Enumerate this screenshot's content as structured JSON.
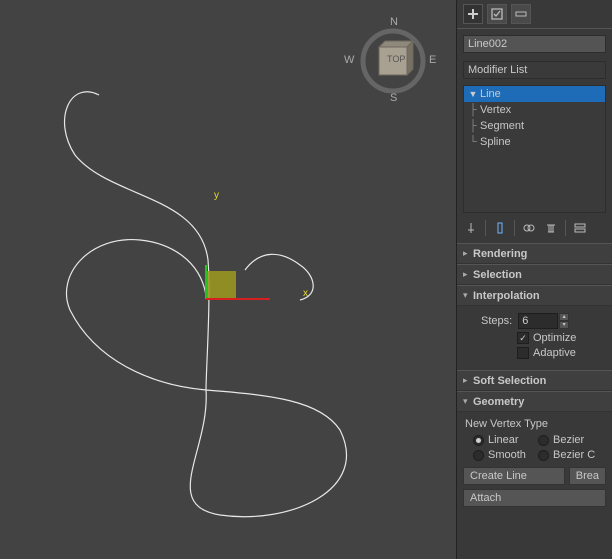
{
  "object_name": "Line002",
  "modifier_dropdown": "Modifier List",
  "stack": {
    "root": "Line",
    "subs": [
      "Vertex",
      "Segment",
      "Spline"
    ]
  },
  "rollouts": {
    "rendering": "Rendering",
    "selection": "Selection",
    "interpolation": "Interpolation",
    "soft_selection": "Soft Selection",
    "geometry": "Geometry"
  },
  "interpolation": {
    "steps_label": "Steps:",
    "steps_value": "6",
    "optimize_label": "Optimize",
    "optimize_checked": true,
    "adaptive_label": "Adaptive",
    "adaptive_checked": false
  },
  "geometry": {
    "new_vertex_label": "New Vertex Type",
    "linear": "Linear",
    "bezier": "Bezier",
    "smooth": "Smooth",
    "bezier_corner": "Bezier C",
    "selected": "linear",
    "create_line": "Create Line",
    "break": "Brea",
    "attach": "Attach"
  },
  "gizmo": {
    "x": "x",
    "y": "y"
  },
  "navcube": {
    "face": "TOP",
    "n": "N",
    "s": "S",
    "e": "E",
    "w": "W"
  },
  "icons": {
    "plus": "plus-icon",
    "box": "box-icon",
    "pin": "pin-icon",
    "test_tube": "preview-icon",
    "config": "config-icon",
    "trash": "trash-icon",
    "layers": "layers-icon"
  }
}
